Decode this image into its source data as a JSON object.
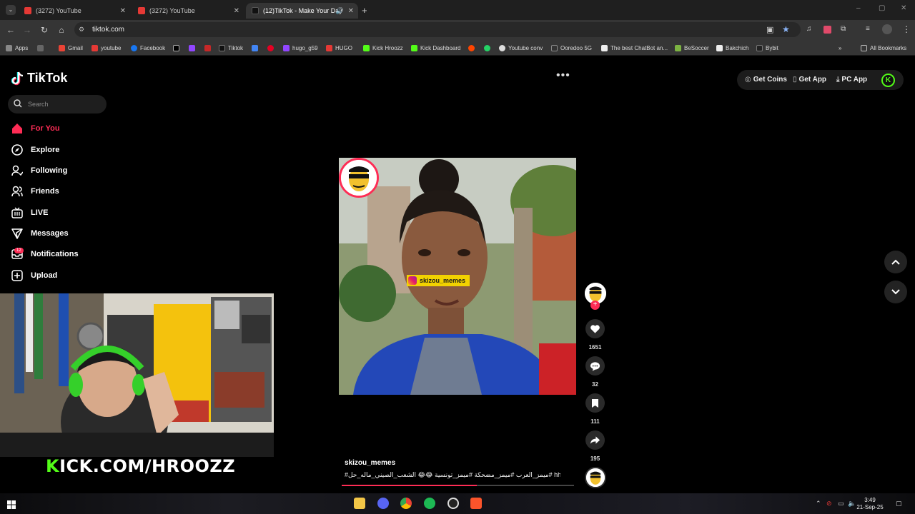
{
  "browser": {
    "tabs": [
      {
        "label": "(3272) YouTube",
        "active": false
      },
      {
        "label": "(3272) YouTube",
        "active": false
      },
      {
        "label": "(12)TikTok - Make Your Day",
        "active": true
      }
    ],
    "url": "tiktok.com",
    "bookmarks": [
      "Apps",
      "Gmail",
      "youtube",
      "Facebook",
      "Tiktok",
      "hugo_g59",
      "HUGO",
      "Kick Hroozz",
      "Kick Dashboard",
      "Youtube conv",
      "Ooredoo 5G",
      "The best ChatBot an...",
      "BeSoccer",
      "Bakchich",
      "Bybit",
      "All Bookmarks"
    ]
  },
  "sidebar": {
    "logo": "TikTok",
    "search_placeholder": "Search",
    "items": [
      {
        "label": "For You",
        "icon": "home-icon",
        "active": true
      },
      {
        "label": "Explore",
        "icon": "compass-icon"
      },
      {
        "label": "Following",
        "icon": "following-icon"
      },
      {
        "label": "Friends",
        "icon": "friends-icon"
      },
      {
        "label": "LIVE",
        "icon": "live-icon"
      },
      {
        "label": "Messages",
        "icon": "messages-icon"
      },
      {
        "label": "Notifications",
        "icon": "inbox-icon",
        "badge": "12"
      },
      {
        "label": "Upload",
        "icon": "upload-icon"
      }
    ]
  },
  "overlay": {
    "kick_prefix": "K",
    "kick_rest": "ICK.COM/HROOZZ"
  },
  "video": {
    "watermark": "skizou_memes",
    "author": "skizou_memes",
    "caption": "#ميمز_العرب #ميمز_مضحكة #ميمز_تونسية 😂😂 الشعب_الصيني_ماله_حل# hhhhhhhh",
    "progress": 0.58,
    "likes": "1651",
    "comments": "32",
    "saves": "111",
    "shares": "195"
  },
  "topbar": {
    "get_coins": "Get Coins",
    "get_app": "Get App",
    "pc_app": "PC App",
    "kick_badge": "K"
  },
  "taskbar": {
    "time": "3:49",
    "date": "21-Sep-25"
  },
  "colors": {
    "tiktok_red": "#fe2c55",
    "kick_green": "#53fc18",
    "watermark_yellow": "#f2d200"
  }
}
